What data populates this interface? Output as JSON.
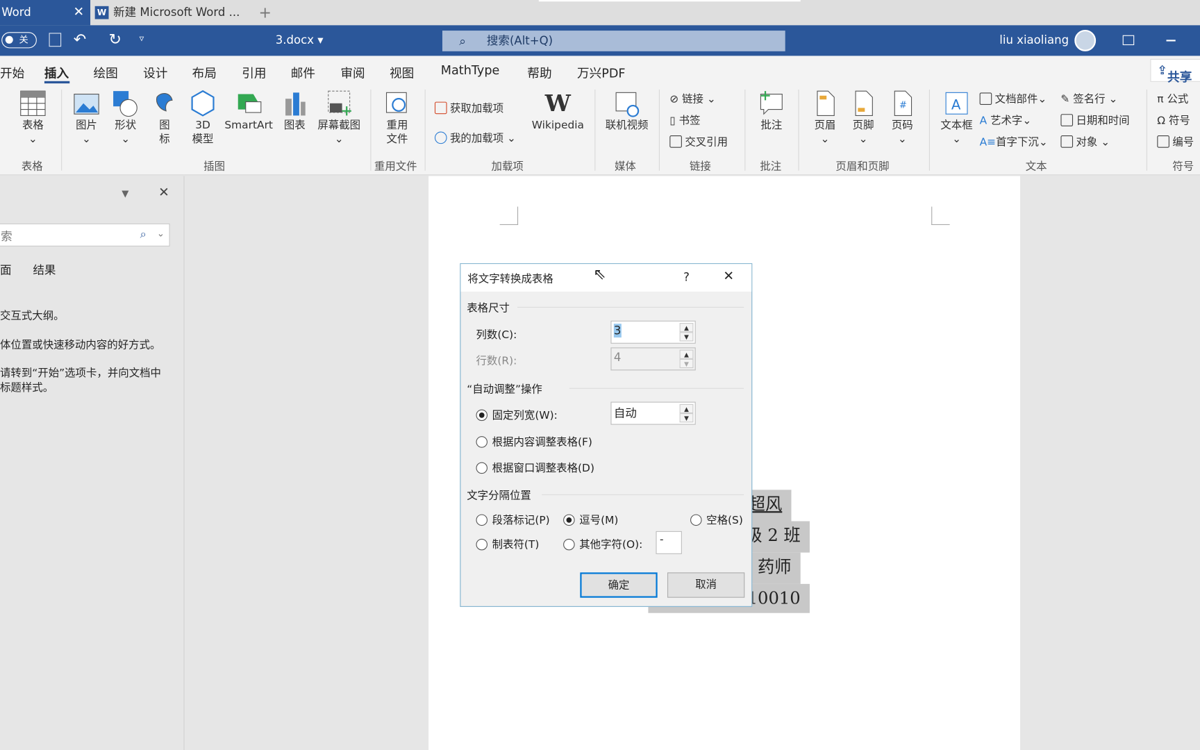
{
  "tabs": [
    {
      "label": "Word",
      "close": "✕"
    },
    {
      "label": "新建 Microsoft Word ...",
      "icon": "W"
    }
  ],
  "new_tab": "+",
  "titlebar": {
    "toggle": "关",
    "doc_name": "3.docx ▾",
    "search_placeholder": "搜索(Alt+Q)",
    "user": "liu xiaoliang"
  },
  "menu": [
    "开始",
    "插入",
    "绘图",
    "设计",
    "布局",
    "引用",
    "邮件",
    "审阅",
    "视图",
    "MathType",
    "帮助",
    "万兴PDF"
  ],
  "share": "共享",
  "ribbon": {
    "buttons": [
      {
        "label": "表格"
      },
      {
        "label": "图片"
      },
      {
        "label": "形状"
      },
      {
        "label": "图\n标"
      },
      {
        "label": "3D\n模型"
      },
      {
        "label": "SmartArt"
      },
      {
        "label": "图表"
      },
      {
        "label": "屏幕截图"
      },
      {
        "label": "重用\n文件"
      },
      {
        "label": "Wikipedia"
      },
      {
        "label": "联机视频"
      },
      {
        "label": "批注"
      },
      {
        "label": "页眉"
      },
      {
        "label": "页脚"
      },
      {
        "label": "页码"
      },
      {
        "label": "文本框"
      }
    ],
    "small": [
      "获取加载项",
      "我的加载项",
      "链接",
      "书签",
      "交叉引用",
      "文档部件",
      "艺术字",
      "首字下沉",
      "签名行",
      "日期和时间",
      "对象",
      "公式",
      "符号",
      "编号"
    ],
    "groups": [
      "表格",
      "插图",
      "重用文件",
      "加载项",
      "媒体",
      "链接",
      "批注",
      "页眉和页脚",
      "文本",
      "符号"
    ]
  },
  "nav_pane": {
    "search_placeholder": "索",
    "tabs": [
      "面",
      "结果"
    ],
    "lines": [
      "交互式大纲。",
      "体位置或快速移动内容的好方式。",
      "请转到“开始”选项卡，并向文档中",
      "标题样式。"
    ]
  },
  "document": {
    "fragments": [
      "超风",
      "级 2 班",
      "药师",
      "510010"
    ]
  },
  "dialog": {
    "title": "将文字转换成表格",
    "help": "?",
    "close": "✕",
    "size_section": "表格尺寸",
    "cols_label": "列数(C):",
    "cols_value": "3",
    "rows_label": "行数(R):",
    "rows_value": "4",
    "autofit_section": "“自动调整”操作",
    "fixed_label": "固定列宽(W):",
    "fixed_value": "自动",
    "content_label": "根据内容调整表格(F)",
    "window_label": "根据窗口调整表格(D)",
    "sep_section": "文字分隔位置",
    "para_label": "段落标记(P)",
    "comma_label": "逗号(M)",
    "space_label": "空格(S)",
    "tab_label": "制表符(T)",
    "other_label": "其他字符(O):",
    "other_value": "-",
    "ok": "确定",
    "cancel": "取消",
    "selected_autofit": "fixed",
    "selected_separator": "comma"
  },
  "colors": {
    "accent": "#2b579a",
    "dialog_border": "#7fb2cf"
  }
}
